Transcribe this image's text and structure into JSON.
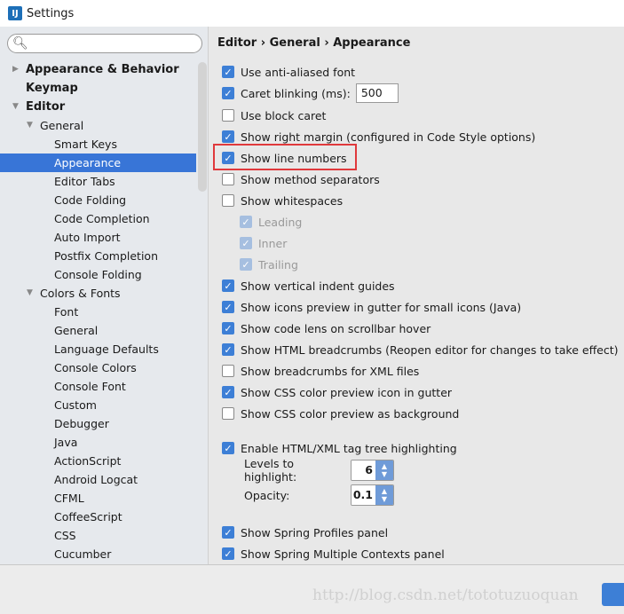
{
  "window": {
    "title": "Settings"
  },
  "search": {
    "placeholder": ""
  },
  "tree": [
    {
      "label": "Appearance & Behavior",
      "level": 0,
      "bold": true,
      "arrow": "right"
    },
    {
      "label": "Keymap",
      "level": 0,
      "bold": true,
      "arrow": ""
    },
    {
      "label": "Editor",
      "level": 0,
      "bold": true,
      "arrow": "down"
    },
    {
      "label": "General",
      "level": 1,
      "arrow": "down"
    },
    {
      "label": "Smart Keys",
      "level": 2
    },
    {
      "label": "Appearance",
      "level": 2,
      "selected": true
    },
    {
      "label": "Editor Tabs",
      "level": 2
    },
    {
      "label": "Code Folding",
      "level": 2
    },
    {
      "label": "Code Completion",
      "level": 2
    },
    {
      "label": "Auto Import",
      "level": 2
    },
    {
      "label": "Postfix Completion",
      "level": 2
    },
    {
      "label": "Console Folding",
      "level": 2
    },
    {
      "label": "Colors & Fonts",
      "level": 1,
      "arrow": "down"
    },
    {
      "label": "Font",
      "level": 2
    },
    {
      "label": "General",
      "level": 2
    },
    {
      "label": "Language Defaults",
      "level": 2
    },
    {
      "label": "Console Colors",
      "level": 2
    },
    {
      "label": "Console Font",
      "level": 2
    },
    {
      "label": "Custom",
      "level": 2
    },
    {
      "label": "Debugger",
      "level": 2
    },
    {
      "label": "Java",
      "level": 2
    },
    {
      "label": "ActionScript",
      "level": 2
    },
    {
      "label": "Android Logcat",
      "level": 2
    },
    {
      "label": "CFML",
      "level": 2
    },
    {
      "label": "CoffeeScript",
      "level": 2
    },
    {
      "label": "CSS",
      "level": 2
    },
    {
      "label": "Cucumber",
      "level": 2
    }
  ],
  "breadcrumb": "Editor › General › Appearance",
  "options": [
    {
      "label": "Use anti-aliased font",
      "checked": true
    },
    {
      "label": "Caret blinking (ms):",
      "checked": true,
      "input": "500"
    },
    {
      "label": "Use block caret",
      "checked": false
    },
    {
      "label": "Show right margin (configured in Code Style options)",
      "checked": true
    },
    {
      "label": "Show line numbers",
      "checked": true,
      "highlighted": true
    },
    {
      "label": "Show method separators",
      "checked": false
    },
    {
      "label": "Show whitespaces",
      "checked": false
    },
    {
      "label": "Leading",
      "checked": true,
      "disabled": true,
      "indent": true
    },
    {
      "label": "Inner",
      "checked": true,
      "disabled": true,
      "indent": true
    },
    {
      "label": "Trailing",
      "checked": true,
      "disabled": true,
      "indent": true
    },
    {
      "label": "Show vertical indent guides",
      "checked": true
    },
    {
      "label": "Show icons preview in gutter for small icons (Java)",
      "checked": true
    },
    {
      "label": "Show code lens on scrollbar hover",
      "checked": true
    },
    {
      "label": "Show HTML breadcrumbs (Reopen editor for changes to take effect)",
      "checked": true
    },
    {
      "label": "Show breadcrumbs for XML files",
      "checked": false
    },
    {
      "label": "Show CSS color preview icon in gutter",
      "checked": true
    },
    {
      "label": "Show CSS color preview as background",
      "checked": false
    }
  ],
  "tag_tree": {
    "label": "Enable HTML/XML tag tree highlighting",
    "checked": true,
    "levels_label": "Levels to highlight:",
    "levels_value": "6",
    "opacity_label": "Opacity:",
    "opacity_value": "0.1"
  },
  "spring": [
    {
      "label": "Show Spring Profiles panel",
      "checked": true
    },
    {
      "label": "Show Spring Multiple Contexts panel",
      "checked": true
    }
  ],
  "watermark": "http://blog.csdn.net/tototuzuoquan",
  "colors": {
    "accent": "#3875d7",
    "highlight_box": "#e0393c"
  }
}
